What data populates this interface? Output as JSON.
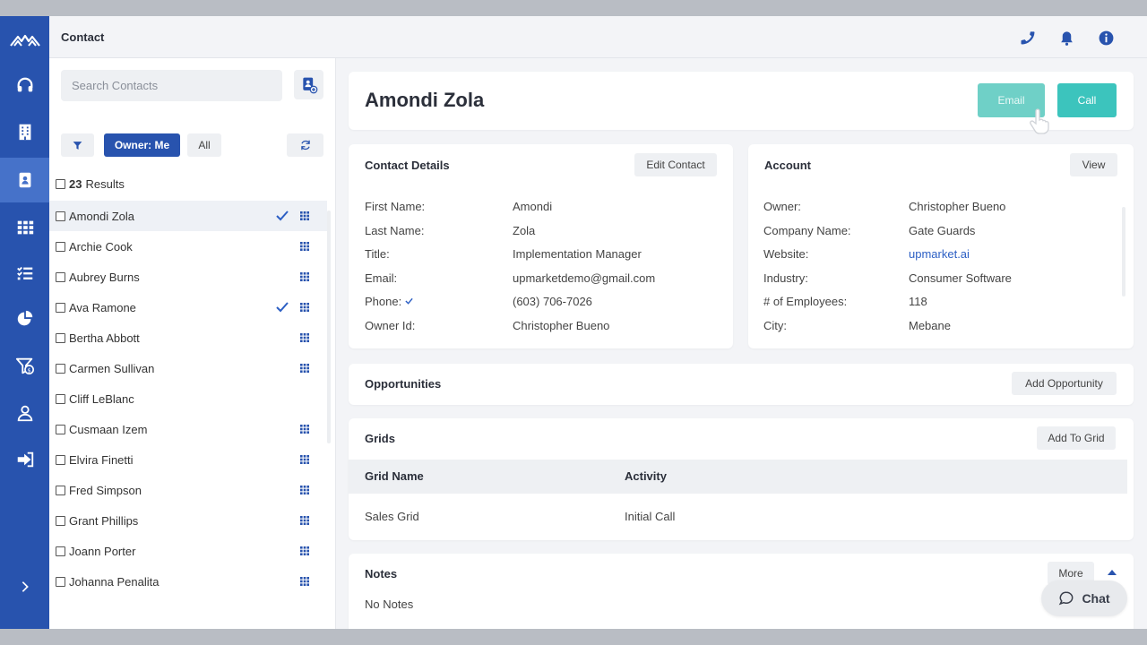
{
  "topbar": {
    "title": "Contact"
  },
  "list": {
    "search_placeholder": "Search Contacts",
    "owner_filter": "Owner: Me",
    "all_filter": "All",
    "results_count": "23",
    "results_label": "Results",
    "contacts": [
      {
        "name": "Amondi Zola",
        "selected": true,
        "checked_mark": true,
        "grid": true
      },
      {
        "name": "Archie Cook",
        "selected": false,
        "checked_mark": false,
        "grid": true
      },
      {
        "name": "Aubrey Burns",
        "selected": false,
        "checked_mark": false,
        "grid": true
      },
      {
        "name": "Ava Ramone",
        "selected": false,
        "checked_mark": true,
        "grid": true
      },
      {
        "name": "Bertha Abbott",
        "selected": false,
        "checked_mark": false,
        "grid": true
      },
      {
        "name": "Carmen Sullivan",
        "selected": false,
        "checked_mark": false,
        "grid": true
      },
      {
        "name": "Cliff LeBlanc",
        "selected": false,
        "checked_mark": false,
        "grid": false
      },
      {
        "name": "Cusmaan Izem",
        "selected": false,
        "checked_mark": false,
        "grid": true
      },
      {
        "name": "Elvira Finetti",
        "selected": false,
        "checked_mark": false,
        "grid": true
      },
      {
        "name": "Fred Simpson",
        "selected": false,
        "checked_mark": false,
        "grid": true
      },
      {
        "name": "Grant Phillips",
        "selected": false,
        "checked_mark": false,
        "grid": true
      },
      {
        "name": "Joann Porter",
        "selected": false,
        "checked_mark": false,
        "grid": true
      },
      {
        "name": "Johanna Penalita",
        "selected": false,
        "checked_mark": false,
        "grid": true
      }
    ]
  },
  "contact": {
    "name": "Amondi Zola",
    "email_btn": "Email",
    "call_btn": "Call"
  },
  "details": {
    "title": "Contact Details",
    "edit_btn": "Edit Contact",
    "labels": {
      "first": "First Name:",
      "last": "Last Name:",
      "title": "Title:",
      "email": "Email:",
      "phone": "Phone:",
      "owner": "Owner Id:"
    },
    "values": {
      "first": "Amondi",
      "last": "Zola",
      "title": "Implementation Manager",
      "email": "upmarketdemo@gmail.com",
      "phone": "(603) 706-7026",
      "owner": "Christopher Bueno"
    }
  },
  "account": {
    "title": "Account",
    "view_btn": "View",
    "labels": {
      "owner": "Owner:",
      "company": "Company Name:",
      "website": "Website:",
      "industry": "Industry:",
      "employees": "# of Employees:",
      "city": "City:"
    },
    "values": {
      "owner": "Christopher Bueno",
      "company": "Gate Guards",
      "website": "upmarket.ai",
      "industry": "Consumer Software",
      "employees": "118",
      "city": "Mebane"
    }
  },
  "opportunities": {
    "title": "Opportunities",
    "add_btn": "Add Opportunity"
  },
  "grids": {
    "title": "Grids",
    "add_btn": "Add To Grid",
    "col_name": "Grid Name",
    "col_activity": "Activity",
    "rows": [
      {
        "name": "Sales Grid",
        "activity": "Initial Call"
      }
    ]
  },
  "notes": {
    "title": "Notes",
    "more_btn": "More",
    "empty": "No Notes"
  },
  "chat": {
    "label": "Chat"
  },
  "colors": {
    "nav": "#2853ae",
    "nav_active": "#4672c9",
    "teal": "#3cc4bd",
    "teal_light": "#6fd0c7",
    "link": "#2c5fc4"
  },
  "icons": {
    "nav": [
      "logo-icon",
      "headset-icon",
      "building-icon",
      "contact-card-icon",
      "grid-icon",
      "checklist-icon",
      "pie-chart-icon",
      "funnel-dollar-icon",
      "user-icon",
      "sign-out-icon",
      "chevron-right-icon"
    ],
    "top": [
      "phone-icon",
      "bell-icon",
      "info-icon"
    ]
  }
}
